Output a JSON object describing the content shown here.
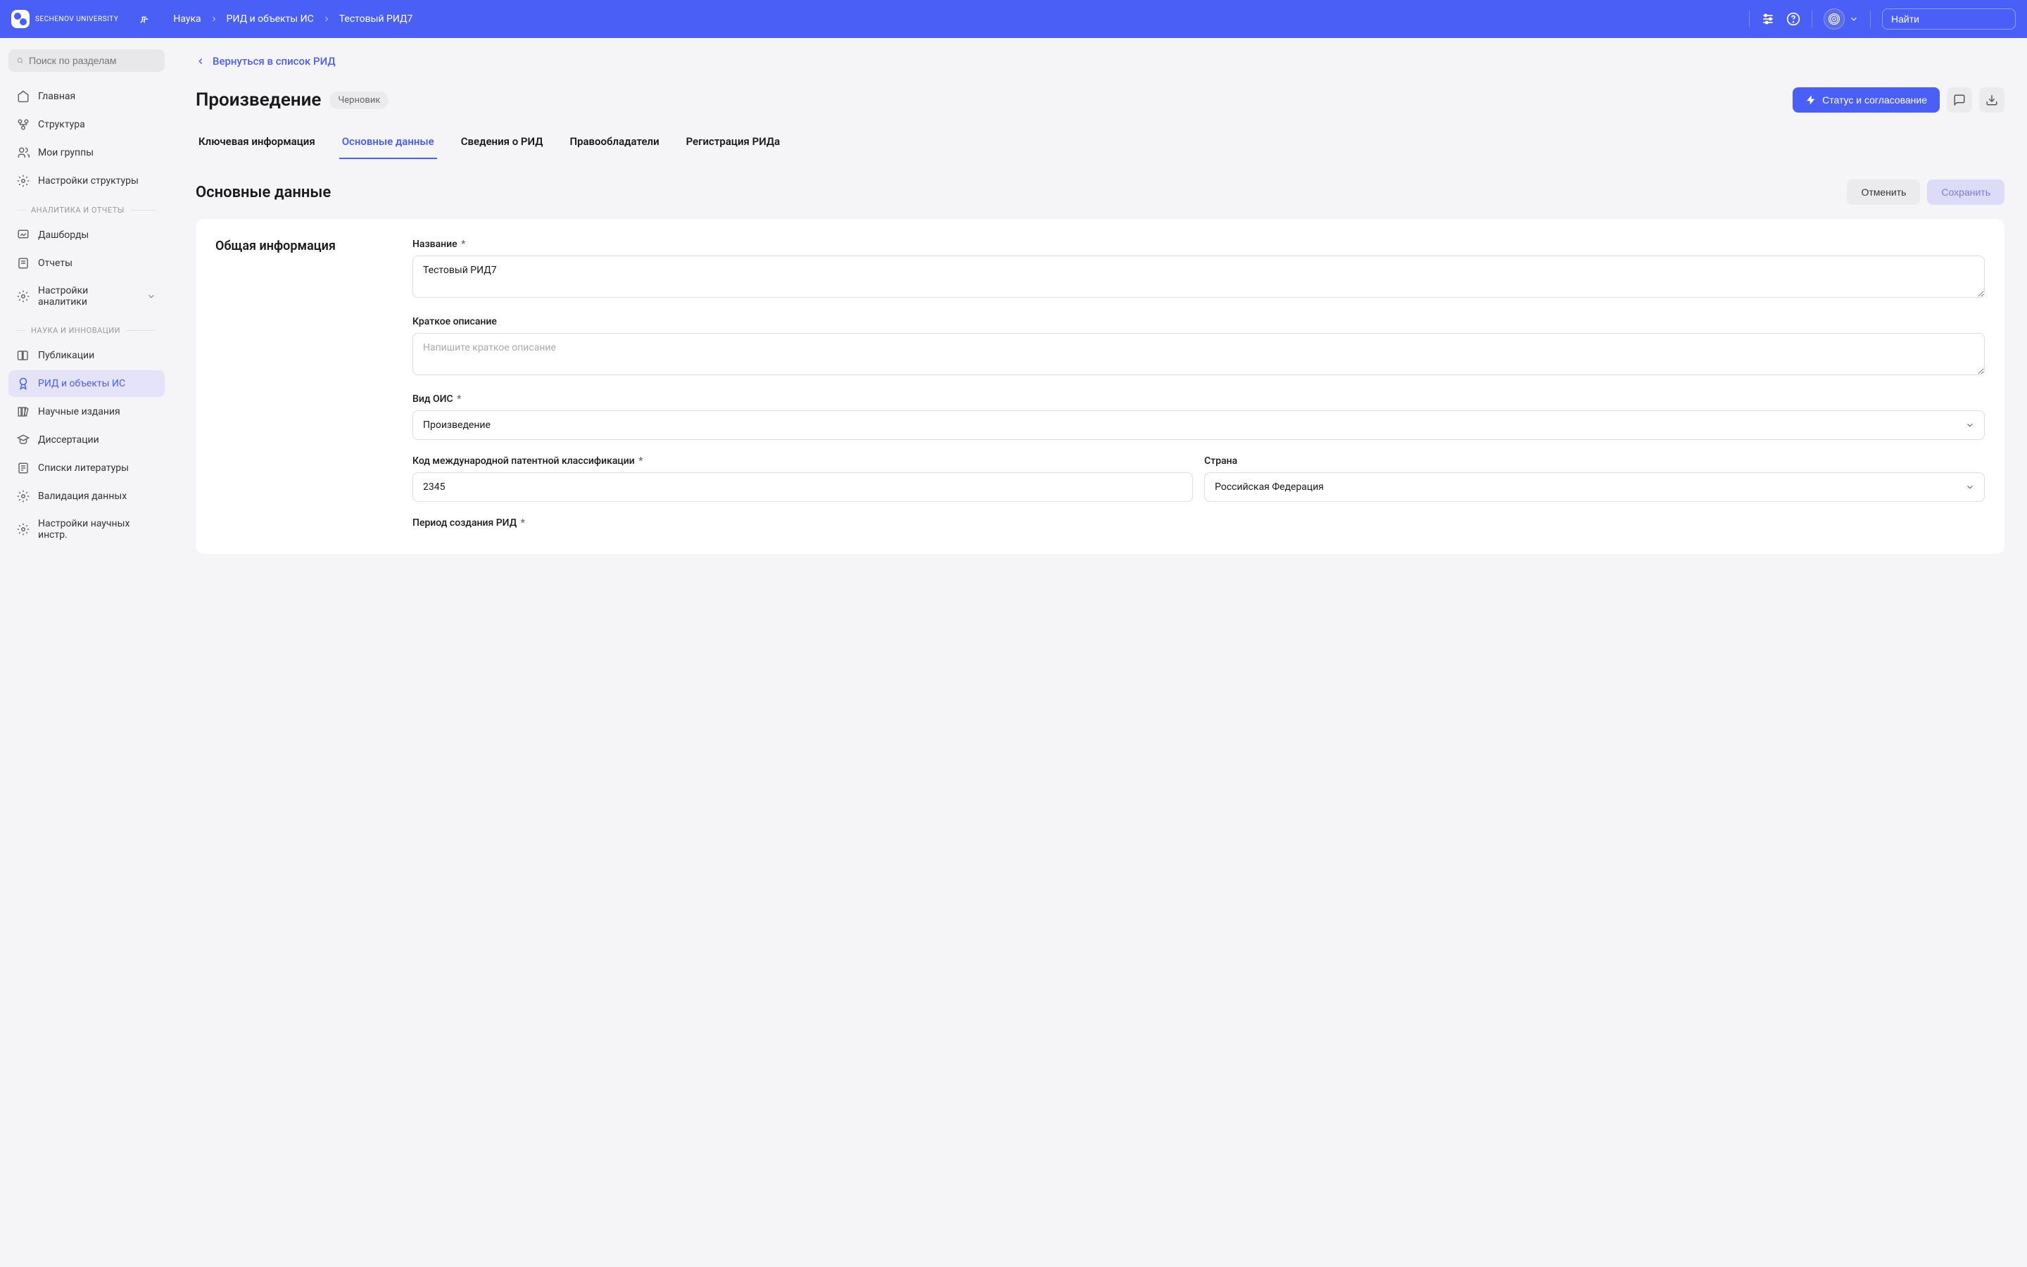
{
  "header": {
    "logo_text": "Sechenov\nUniversity",
    "breadcrumb": [
      "Наука",
      "РИД и объекты ИС",
      "Тестовый РИД7"
    ],
    "search_placeholder": "Найти"
  },
  "sidebar": {
    "search_placeholder": "Поиск по разделам",
    "top_items": [
      {
        "label": "Главная",
        "icon": "home"
      },
      {
        "label": "Структура",
        "icon": "org"
      },
      {
        "label": "Мои группы",
        "icon": "group"
      },
      {
        "label": "Настройки структуры",
        "icon": "gear"
      }
    ],
    "sections": [
      {
        "title": "Аналитика и отчеты",
        "items": [
          {
            "label": "Дашборды",
            "icon": "dashboard"
          },
          {
            "label": "Отчеты",
            "icon": "report"
          },
          {
            "label": "Настройки аналитики",
            "icon": "gear",
            "expandable": true
          }
        ]
      },
      {
        "title": "Наука и инновации",
        "items": [
          {
            "label": "Публикации",
            "icon": "book"
          },
          {
            "label": "РИД и объекты ИС",
            "icon": "award",
            "active": true
          },
          {
            "label": "Научные издания",
            "icon": "books"
          },
          {
            "label": "Диссертации",
            "icon": "grad"
          },
          {
            "label": "Списки литературы",
            "icon": "list"
          },
          {
            "label": "Валидация данных",
            "icon": "gear"
          },
          {
            "label": "Настройки научных инстр.",
            "icon": "gear"
          }
        ]
      }
    ]
  },
  "main": {
    "back_link": "Вернуться в список РИД",
    "page_title": "Произведение",
    "badge": "Черновик",
    "status_button": "Статус и согласование",
    "tabs": [
      "Ключевая информация",
      "Основные данные",
      "Сведения о РИД",
      "Правообладатели",
      "Регистрация РИДа"
    ],
    "active_tab": 1,
    "section_title": "Основные данные",
    "cancel_button": "Отменить",
    "save_button": "Сохранить",
    "card_title": "Общая информация",
    "form": {
      "name_label": "Название",
      "name_value": "Тестовый РИД7",
      "desc_label": "Краткое описание",
      "desc_placeholder": "Напишите краткое описание",
      "type_label": "Вид ОИС",
      "type_value": "Произведение",
      "code_label": "Код международной патентной классификации",
      "code_value": "2345",
      "country_label": "Страна",
      "country_value": "Российская Федерация",
      "period_label": "Период создания РИД"
    }
  }
}
